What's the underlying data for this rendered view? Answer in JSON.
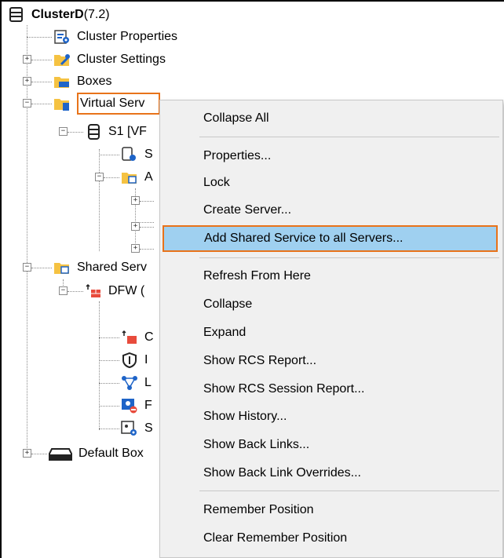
{
  "tree": {
    "root": {
      "label": "ClusterD",
      "version": "(7.2)"
    },
    "cluster_properties": "Cluster Properties",
    "cluster_settings": "Cluster Settings",
    "boxes": "Boxes",
    "virtual_servers": "Virtual Serv",
    "s1": "S1 [VF",
    "s1_child1": "S",
    "s1_child2": "A",
    "shared_services": "Shared Serv",
    "dfw": "DFW (",
    "dfw_child1": "C",
    "dfw_child2": "I",
    "dfw_child3": "L",
    "dfw_child4": "F",
    "dfw_child5": "S",
    "default_box": "Default Box"
  },
  "menu": {
    "items": [
      "Collapse All",
      "Properties...",
      "Lock",
      "Create Server...",
      "Add Shared Service to all Servers...",
      "Refresh From Here",
      "Collapse",
      "Expand",
      "Show RCS Report...",
      "Show RCS Session Report...",
      "Show History...",
      "Show Back Links...",
      "Show Back Link Overrides...",
      "Remember Position",
      "Clear Remember Position"
    ],
    "highlighted_index": 4
  },
  "colors": {
    "highlight_bg": "#9fd0f0",
    "accent_border": "#e8731a",
    "folder": "#f5c242"
  }
}
